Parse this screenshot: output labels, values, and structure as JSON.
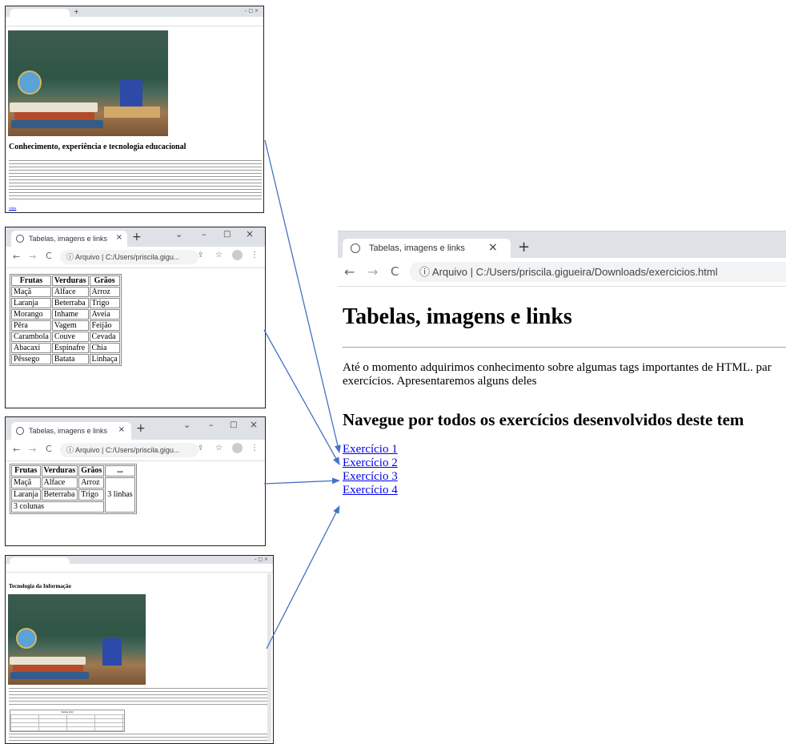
{
  "main_window": {
    "tab_title": "Tabelas, imagens e links",
    "address_prefix": "Arquivo",
    "address_url": "C:/Users/priscila.gigueira/Downloads/exercicios.html",
    "heading": "Tabelas, imagens e links",
    "intro_text": "Até o momento adquirimos conhecimento sobre algumas tags importantes de HTML. par exercícios. Apresentaremos alguns deles",
    "subheading": "Navegue por todos os exercícios desenvolvidos deste tem",
    "links": [
      "Exercício 1",
      "Exercício 2",
      "Exercício 3",
      "Exercício 4"
    ]
  },
  "shot1": {
    "heading": "Conhecimento, experiência e tecnologia educacional",
    "link": "voltar"
  },
  "shot2": {
    "tab_title": "Tabelas, imagens e links",
    "address_prefix": "Arquivo",
    "address_url": "C:/Users/priscila.gigu...",
    "headers": [
      "Frutas",
      "Verduras",
      "Grãos"
    ],
    "rows": [
      [
        "Maçã",
        "Alface",
        "Arroz"
      ],
      [
        "Laranja",
        "Beterraba",
        "Trigo"
      ],
      [
        "Morango",
        "Inhame",
        "Aveia"
      ],
      [
        "Pêra",
        "Vagem",
        "Feijão"
      ],
      [
        "Carambola",
        "Couve",
        "Cevada"
      ],
      [
        "Abacaxi",
        "Espinafre",
        "Chia"
      ],
      [
        "Pêssego",
        "Batata",
        "Linhaça"
      ]
    ]
  },
  "shot3": {
    "tab_title": "Tabelas, imagens e links",
    "address_prefix": "Arquivo",
    "address_url": "C:/Users/priscila.gigu...",
    "headers": [
      "Frutas",
      "Verduras",
      "Grãos",
      "..."
    ],
    "rows": [
      [
        "Maçã",
        "Alface",
        "Arroz"
      ],
      [
        "Laranja",
        "Beterraba",
        "Trigo"
      ]
    ],
    "rowspan_cell": "3 linhas",
    "colspan_cell": "3 colunas"
  },
  "shot4": {
    "heading": "Tecnologia da Informação",
    "table_caption": "Turmas 2022"
  },
  "colors": {
    "arrow": "#4472c4",
    "link": "#0000ee",
    "chrome": "#dee1e6"
  }
}
